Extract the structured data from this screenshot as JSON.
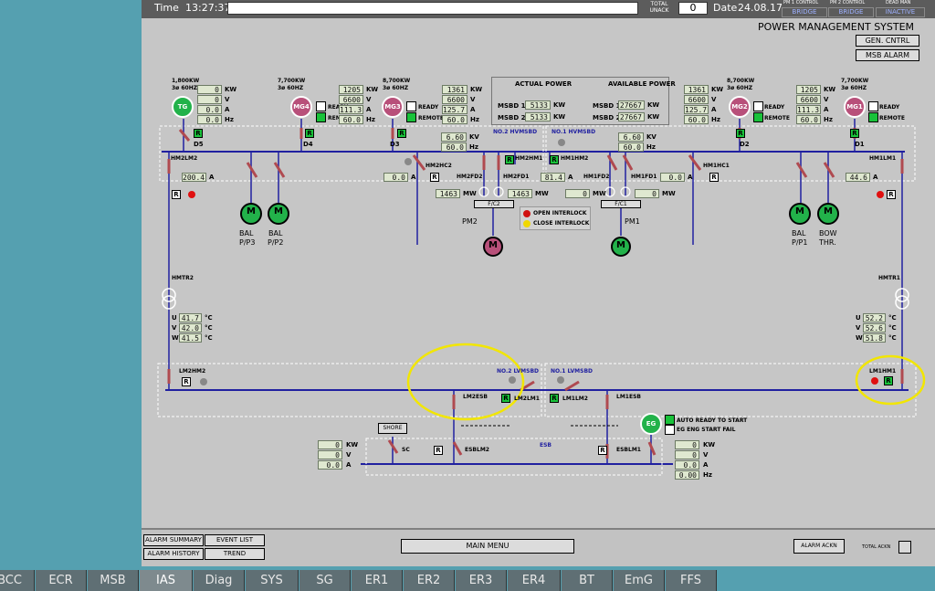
{
  "header": {
    "time_label": "Time",
    "time_value": "13:27:37",
    "total_unack_label": "TOTAL UNACK",
    "total_unack_value": "0",
    "date_label": "Date",
    "date_value": "24.08.17",
    "controls": [
      {
        "title": "PM 1 CONTROL",
        "value": "BRIDGE"
      },
      {
        "title": "PM 2 CONTROL",
        "value": "BRIDGE"
      },
      {
        "title": "DEAD MAN",
        "value": "INACTIVE"
      }
    ]
  },
  "title": "POWER MANAGEMENT SYSTEM",
  "buttons": {
    "gen_cntrl": "GEN. CNTRL",
    "msb_alarm": "MSB ALARM"
  },
  "power_panel": {
    "actual_label": "ACTUAL POWER",
    "available_label": "AVAILABLE POWER",
    "rows": [
      {
        "name": "MSBD 1",
        "actual": "5133",
        "available": "27667"
      },
      {
        "name": "MSBD 2",
        "actual": "5133",
        "available": "27667"
      }
    ],
    "unit": "KW"
  },
  "units": {
    "kw": "KW",
    "v": "V",
    "a": "A",
    "hz": "Hz",
    "kv": "KV",
    "mw": "MW",
    "c": "°C"
  },
  "generators": [
    {
      "name": "TG",
      "rating": "1,800KW",
      "freq": "3ø 60HZ",
      "values": [
        "0",
        "0",
        "0.0",
        "0.0"
      ],
      "breaker": "D5"
    },
    {
      "name": "MG4",
      "rating": "7,700KW",
      "freq": "3ø 60HZ",
      "values": [
        "1205",
        "6600",
        "111.3",
        "60.0"
      ],
      "breaker": "D4"
    },
    {
      "name": "MG3",
      "rating": "8,700KW",
      "freq": "3ø 60HZ",
      "values": [
        "1361",
        "6600",
        "125.7",
        "60.0"
      ],
      "breaker": "D3"
    },
    {
      "name": "MG2",
      "rating": "8,700KW",
      "freq": "3ø 60HZ",
      "values": [
        "1361",
        "6600",
        "125.7",
        "60.0"
      ],
      "breaker": "D2"
    },
    {
      "name": "MG1",
      "rating": "7,700KW",
      "freq": "3ø 60HZ",
      "values": [
        "1205",
        "6600",
        "111.3",
        "60.0"
      ],
      "breaker": "D1"
    }
  ],
  "status": {
    "ready": "READY",
    "remote": "REMOTE"
  },
  "hv": {
    "no2_label": "NO.2 HVMSBD",
    "no1_label": "NO.1 HVMSBD",
    "kv_left": "6.60",
    "hz_left": "60.0",
    "kv_right": "6.60",
    "hz_right": "60.0",
    "hm2lm2": "HM2LM2",
    "hm2lm2_a": "200.4",
    "hm1lm1": "HM1LM1",
    "hm1lm1_a": "44.6",
    "hm2hc2": "HM2HC2",
    "hm2hc2_a": "0.0",
    "hm1hc1": "HM1HC1",
    "hm1hc1_a": "0.0",
    "hm2hm1": "HM2HM1",
    "hm1hm2": "HM1HM2",
    "hm2fd2": "HM2FD2",
    "hm2fd1": "HM2FD1",
    "hm2fd1_a": "81.4",
    "hm1fd2": "HM1FD2",
    "hm1fd1": "HM1FD1",
    "pm2_mw": "1463",
    "pm2_mw2": "1463",
    "pm1_mw": "0",
    "pm1_mw2": "0",
    "fc2": "F/C2",
    "fc1": "F/C1",
    "pm2": "PM2",
    "pm1": "PM1",
    "open_interlock": "OPEN INTERLOCK",
    "close_interlock": "CLOSE INTERLOCK"
  },
  "motors": [
    {
      "label1": "BAL",
      "label2": "P/P3"
    },
    {
      "label1": "BAL",
      "label2": "P/P2"
    },
    {
      "label1": "BAL",
      "label2": "P/P1"
    },
    {
      "label1": "BOW",
      "label2": "THR."
    }
  ],
  "motor_symbol": "M",
  "transformers": {
    "hmtr2": "HMTR2",
    "hmtr1": "HMTR1",
    "left_temps": [
      {
        "ph": "U",
        "val": "41.7"
      },
      {
        "ph": "V",
        "val": "42.0"
      },
      {
        "ph": "W",
        "val": "41.5"
      }
    ],
    "right_temps": [
      {
        "ph": "U",
        "val": "52.2"
      },
      {
        "ph": "V",
        "val": "52.6"
      },
      {
        "ph": "W",
        "val": "51.8"
      }
    ]
  },
  "lv": {
    "lm2hm2": "LM2HM2",
    "lm1hm1": "LM1HM1",
    "no2_label": "NO.2 LVMSBD",
    "no1_label": "NO.1 LVMSBD",
    "lm2lm1": "LM2LM1",
    "lm1lm2": "LM1LM2",
    "lm2esb": "LM2ESB",
    "lm1esb": "LM1ESB"
  },
  "esb": {
    "shore": "SHORE",
    "sc": "SC",
    "esblm2": "ESBLM2",
    "esblm1": "ESBLM1",
    "esb_label": "ESB",
    "shore_values": [
      "0",
      "0",
      "0.0"
    ],
    "eg_name": "EG",
    "eg_values": [
      "0",
      "0",
      "0.0",
      "0.00"
    ],
    "auto_ready": "AUTO READY TO START",
    "start_fail": "EG ENG START FAIL"
  },
  "footer": {
    "alarm_summary": "ALARM SUMMARY",
    "alarm_history": "ALARM HISTORY",
    "event_list": "EVENT LIST",
    "trend": "TREND",
    "main_menu": "MAIN MENU",
    "alarm_ackn": "ALARM ACKN",
    "total_ackn": "TOTAL ACKN"
  },
  "tabs": [
    "BCC",
    "ECR",
    "MSB",
    "IAS",
    "Diag",
    "SYS",
    "SG",
    "ER1",
    "ER2",
    "ER3",
    "ER4",
    "BT",
    "EmG",
    "FFS"
  ],
  "active_tab": "IAS",
  "colors": {
    "generator_mg": "#b8507a",
    "generator_tg": "#22b24a",
    "motor_green": "#22b24a",
    "bus": "#2020a0",
    "highlight": "#f2e600"
  }
}
